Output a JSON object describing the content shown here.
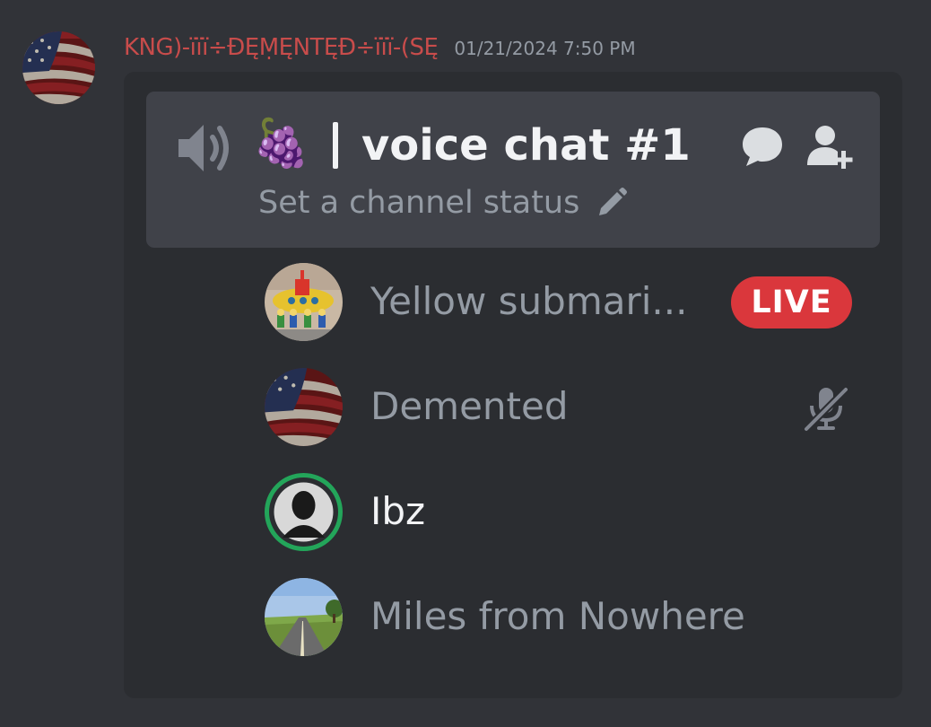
{
  "message": {
    "author": "KNG)-ïïï÷ĐĘṂĘNTĘĐ÷ïïï-(SĘ",
    "timestamp": "01/21/2024 7:50 PM",
    "author_color": "#c84c4b"
  },
  "voice_channel": {
    "emoji": "🍇",
    "name": "voice chat #1",
    "status_placeholder": "Set a channel status",
    "icons": [
      "speaker-icon",
      "chat-bubble-icon",
      "invite-user-icon",
      "pencil-icon"
    ]
  },
  "members": [
    {
      "name": "Yellow submari...",
      "badge": "LIVE",
      "avatar": "yellow-submarine-avatar",
      "active": false
    },
    {
      "name": "Demented",
      "status_icon": "mic-muted-icon",
      "avatar": "flag-avatar",
      "active": false
    },
    {
      "name": "Ibz",
      "speaking": true,
      "avatar": "silhouette-avatar",
      "active": true
    },
    {
      "name": "Miles from Nowhere",
      "avatar": "road-landscape-avatar",
      "active": false
    }
  ],
  "colors": {
    "background": "#313338",
    "embed": "#2b2d31",
    "channel_box": "#404249",
    "live_badge": "#da373c",
    "speaking_ring": "#23a55a"
  }
}
